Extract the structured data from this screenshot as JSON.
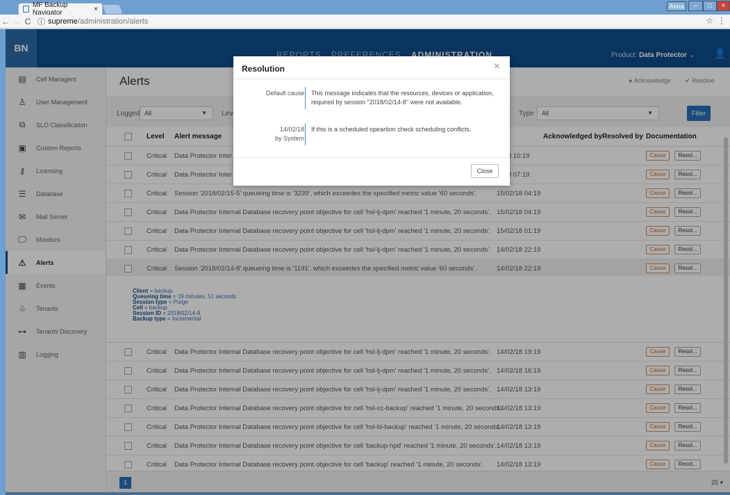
{
  "browser": {
    "tab_title": "MF Backup Navigator",
    "tab_close": "×",
    "user_chip": "Anna",
    "url_host": "supreme",
    "url_path": "/administration/alerts",
    "info_icon": "ⓘ"
  },
  "app": {
    "logo": "BN",
    "nav": [
      "REPORTS",
      "PREFERENCES",
      "ADMINISTRATION"
    ],
    "product_label": "Product:",
    "product_value": "Data Protector"
  },
  "sidebar": {
    "items": [
      {
        "label": "Cell Managers",
        "icon": "server-icon"
      },
      {
        "label": "User Management",
        "icon": "user-icon"
      },
      {
        "label": "SLO Classification",
        "icon": "slo-icon"
      },
      {
        "label": "Custom Reports",
        "icon": "report-icon"
      },
      {
        "label": "Licensing",
        "icon": "key-icon"
      },
      {
        "label": "Database",
        "icon": "database-icon"
      },
      {
        "label": "Mail Server",
        "icon": "mail-icon"
      },
      {
        "label": "Monitors",
        "icon": "monitor-icon"
      },
      {
        "label": "Alerts",
        "icon": "warning-icon",
        "active": true
      },
      {
        "label": "Events",
        "icon": "calendar-icon"
      },
      {
        "label": "Tenants",
        "icon": "tenants-icon"
      },
      {
        "label": "Tenants Discovery",
        "icon": "discovery-icon"
      },
      {
        "label": "Logging",
        "icon": "log-icon"
      }
    ]
  },
  "page": {
    "title": "Alerts",
    "acknowledge": "Acknowledge",
    "resolve": "Resolve"
  },
  "filters": {
    "logged_label": "Logged",
    "logged_value": "All",
    "level_label": "Leve",
    "type_label": "Type",
    "type_value": "All",
    "filter_button": "Filter"
  },
  "table": {
    "headers": {
      "level": "Level",
      "message": "Alert message",
      "created": "ted",
      "acknowledged": "Acknowledged by",
      "resolved": "Resolved by",
      "documentation": "Documentation"
    },
    "cause_label": "Cause",
    "resol_label": "Resol...",
    "rows_top": [
      {
        "level": "Critical",
        "message": "Data Protector Inter",
        "date": "/2/18 10:19"
      },
      {
        "level": "Critical",
        "message": "Data Protector Inter",
        "date": "/2/18 07:19"
      },
      {
        "level": "Critical",
        "message": "Session '2018/02/15-5' queueing time is '3239', which exceedes the specified metric value '60 seconds'.",
        "date": "15/02/18 04:19"
      },
      {
        "level": "Critical",
        "message": "Data Protector Internal Database recovery point objective for cell 'hsl-lj-dpm' reached '1 minute, 20 seconds'.",
        "date": "15/02/18 04:19"
      },
      {
        "level": "Critical",
        "message": "Data Protector Internal Database recovery point objective for cell 'hsl-lj-dpm' reached '1 minute, 20 seconds'.",
        "date": "15/02/18 01:19"
      },
      {
        "level": "Critical",
        "message": "Data Protector Internal Database recovery point objective for cell 'hsl-lj-dpm' reached '1 minute, 20 seconds'.",
        "date": "14/02/18 22:19"
      },
      {
        "level": "Critical",
        "message": "Session '2018/02/14-8' queueing time is '1191', which exceedes the specified metric value '60 seconds'.",
        "date": "14/02/18 22:19"
      }
    ],
    "details": {
      "client_key": "Client",
      "client_val": "backup",
      "queue_key": "Queueing time",
      "queue_val": "19 minutes, 51 seconds",
      "stype_key": "Session type",
      "stype_val": "Purge",
      "cell_key": "Cell",
      "cell_val": "backup",
      "sid_key": "Session ID",
      "sid_val": "2018/02/14-8",
      "btype_key": "Backup type",
      "btype_val": "Incremental",
      "eq": " = "
    },
    "rows_bottom": [
      {
        "level": "Critical",
        "message": "Data Protector Internal Database recovery point objective for cell 'hsl-lj-dpm' reached '1 minute, 20 seconds'.",
        "date": "14/02/18 19:19"
      },
      {
        "level": "Critical",
        "message": "Data Protector Internal Database recovery point objective for cell 'hsl-lj-dpm' reached '1 minute, 20 seconds'.",
        "date": "14/02/18 16:19"
      },
      {
        "level": "Critical",
        "message": "Data Protector Internal Database recovery point objective for cell 'hsl-lj-dpm' reached '1 minute, 20 seconds'.",
        "date": "14/02/18 13:19"
      },
      {
        "level": "Critical",
        "message": "Data Protector Internal Database recovery point objective for cell 'hsl-cc-backup' reached '1 minute, 20 seconds'.",
        "date": "14/02/18 13:19"
      },
      {
        "level": "Critical",
        "message": "Data Protector Internal Database recovery point objective for cell 'hsl-bl-backup' reached '1 minute, 20 seconds'.",
        "date": "14/02/18 13:19"
      },
      {
        "level": "Critical",
        "message": "Data Protector Internal Database recovery point objective for cell 'backup-hpd' reached '1 minute, 20 seconds'.",
        "date": "14/02/18 13:19"
      },
      {
        "level": "Critical",
        "message": "Data Protector Internal Database recovery point objective for cell 'backup' reached '1 minute, 20 seconds'.",
        "date": "14/02/18 13:19"
      }
    ]
  },
  "pager": {
    "page": "1",
    "page_size": "25"
  },
  "modal": {
    "title": "Resolution",
    "r1_key": "Default cause",
    "r1_val": "This message indicates that the resources, devices or application, required by session \"2018/02/14-8\" were not available.",
    "r2_key_date": "14/02/18",
    "r2_key_by": "by System",
    "r2_val": "If this is a scheduled opeartion check scheduling conflicts.",
    "close": "Close"
  },
  "colors": {
    "brand": "#0d4d8c",
    "accent": "#2a70b9",
    "cause": "#c56a2c"
  }
}
